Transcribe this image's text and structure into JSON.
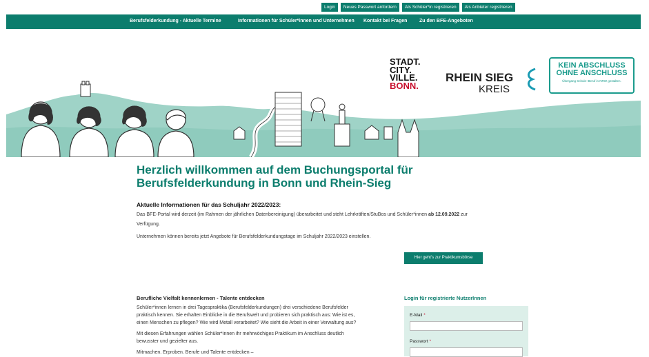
{
  "top_buttons": [
    "Login",
    "Neues Passwort anfordern",
    "Als Schüler*in registrieren",
    "Als Anbieter registrieren"
  ],
  "nav": [
    "Berufsfelderkundung - Aktuelle Termine",
    "Informationen für Schüler*innen und Unternehmen",
    "Kontakt bei Fragen",
    "Zu den BFE-Angeboten"
  ],
  "logos": {
    "bonn_lines": [
      "STADT.",
      "CITY.",
      "VILLE."
    ],
    "bonn_red": "BONN.",
    "rhein_sieg": "RHEIN SIEG",
    "kreis": "KREIS",
    "kao_title1": "KEIN ABSCHLUSS",
    "kao_title2": "OHNE ANSCHLUSS",
    "kao_sub": "Übergang Schule–Beruf in NRW gestalten."
  },
  "main": {
    "title": "Herzlich willkommen auf dem Buchungsportal für Berufsfelderkundung in Bonn und Rhein-Sieg",
    "info_heading": "Aktuelle Informationen für das Schuljahr 2022/2023:",
    "info_p1_a": "Das BFE-Portal wird derzeit (im Rahmen der jährlichen Datenbereinigung) überarbeitet und steht Lehrkräften/StuBos und Schüler*innen ",
    "info_p1_b": "ab 12.09.2022",
    "info_p1_c": " zur",
    "info_p1_d": "Verfügung.",
    "info_p2": "Unternehmen können bereits jetzt Angebote für Berufsfelderkundungstage im Schuljahr 2022/2023 einstellen.",
    "cta": "Hier geht's zur Praktikumsbörse",
    "section_heading": "Berufliche Vielfalt kennenlernen - Talente entdecken",
    "section_p1_l1": "Schüler*innen lernen in drei Tagespraktika (Berufsfelderkundungen) drei verschiedene Berufsfelder",
    "section_p1_l2": "praktisch kennen. Sie erhalten Einblicke in die Berufswelt und probieren sich praktisch aus: Wie ist es,",
    "section_p1_l3": "einen Menschen zu pflegen? Wie wird Metall verarbeitet? Wie sieht die Arbeit in einer Verwaltung aus?",
    "section_p2_l1": "Mit diesen Erfahrungen wählen Schüler*innen ihr mehrwöchiges Praktikum im Anschluss deutlich",
    "section_p2_l2": "bewusster und gezielter aus.",
    "section_p3": "Mitmachen. Erproben. Berufe und Talente entdecken –"
  },
  "login": {
    "heading": "Login für registrierte NutzerInnen",
    "email_label": "E-Mail",
    "password_label": "Passwort",
    "required_mark": "*",
    "email_value": "",
    "password_value": ""
  },
  "colors": {
    "primary": "#0c7d6d",
    "hero_green": "#9fd3c7",
    "accent_red": "#c8102e"
  }
}
